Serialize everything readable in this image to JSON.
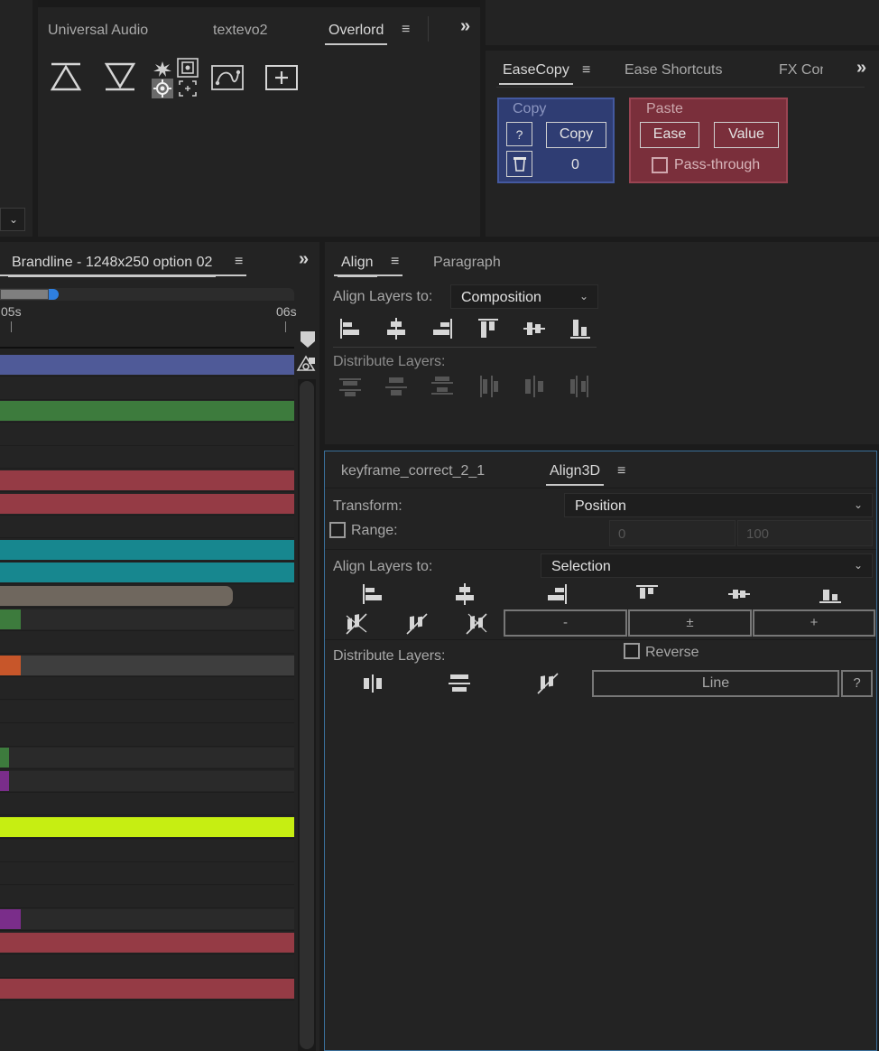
{
  "top_panel": {
    "tabs": [
      "Universal Audio",
      "textevo2",
      "Overlord"
    ],
    "active_tab": "Overlord",
    "menu_glyph": "≡",
    "overflow_glyph": "»",
    "icons": [
      "overlord-push-up-icon",
      "overlord-push-down-icon",
      "explode-icon",
      "frame-icon",
      "target-icon",
      "crop-icon",
      "path-shape-icon",
      "new-comp-icon"
    ]
  },
  "easecopy_panel": {
    "tabs": [
      "EaseCopy",
      "Ease Shortcuts",
      "FX Con"
    ],
    "active_tab": "EaseCopy",
    "copy_group": {
      "title": "Copy",
      "help_label": "?",
      "copy_button": "Copy",
      "count": "0",
      "color": "#2f3d73"
    },
    "paste_group": {
      "title": "Paste",
      "ease_button": "Ease",
      "value_button": "Value",
      "passthrough_label": "Pass-through",
      "passthrough_checked": false,
      "color": "#7a2f3b"
    }
  },
  "timeline": {
    "tab_label": "Brandline - 1248x250 option 02",
    "ruler_labels": [
      "05s",
      "06s"
    ],
    "rows": [
      {
        "color": "#4f5a98",
        "fill": 1.0
      },
      {
        "color": "",
        "fill": 0
      },
      {
        "color": "#3d7b3d",
        "fill": 1.0
      },
      {
        "color": "",
        "fill": 0
      },
      {
        "color": "",
        "fill": 0
      },
      {
        "color": "#953b45",
        "fill": 1.0
      },
      {
        "color": "#953b45",
        "fill": 1.0
      },
      {
        "color": "",
        "fill": 0
      },
      {
        "color": "#17878f",
        "fill": 1.0
      },
      {
        "color": "#17878f",
        "fill": 1.0
      },
      {
        "color": "#6f675e",
        "fill": 0.79
      },
      {
        "color": "#3d7b3d",
        "fill": 0.07
      },
      {
        "color": "",
        "fill": 0
      },
      {
        "color": "#c7562a",
        "fill": 0.07
      },
      {
        "color": "",
        "fill": 0
      },
      {
        "color": "",
        "fill": 0
      },
      {
        "color": "",
        "fill": 0
      },
      {
        "color": "#3d7b3d",
        "fill": 0.03
      },
      {
        "color": "#7a2d8a",
        "fill": 0.03
      },
      {
        "color": "",
        "fill": 0
      },
      {
        "color": "#c6ee12",
        "fill": 1.0
      },
      {
        "color": "",
        "fill": 0
      },
      {
        "color": "",
        "fill": 0
      },
      {
        "color": "",
        "fill": 0
      },
      {
        "color": "#7a2d8a",
        "fill": 0.07
      },
      {
        "color": "#953b45",
        "fill": 1.0
      },
      {
        "color": "",
        "fill": 0
      },
      {
        "color": "#953b45",
        "fill": 1.0
      }
    ]
  },
  "align_panel": {
    "tabs": [
      "Align",
      "Paragraph"
    ],
    "active_tab": "Align",
    "align_to_label": "Align Layers to:",
    "align_to_value": "Composition",
    "distribute_label": "Distribute Layers:"
  },
  "align3d_panel": {
    "tabs": [
      "keyframe_correct_2_1",
      "Align3D"
    ],
    "active_tab": "Align3D",
    "transform_label": "Transform:",
    "transform_value": "Position",
    "range_label": "Range:",
    "range_checked": false,
    "range_from": "0",
    "range_to": "100",
    "align_to_label": "Align Layers to:",
    "align_to_value": "Selection",
    "minus_label": "-",
    "plusminus_label": "±",
    "plus_label": "+",
    "distribute_label": "Distribute Layers:",
    "reverse_label": "Reverse",
    "reverse_checked": false,
    "line_label": "Line",
    "help_label": "?"
  }
}
